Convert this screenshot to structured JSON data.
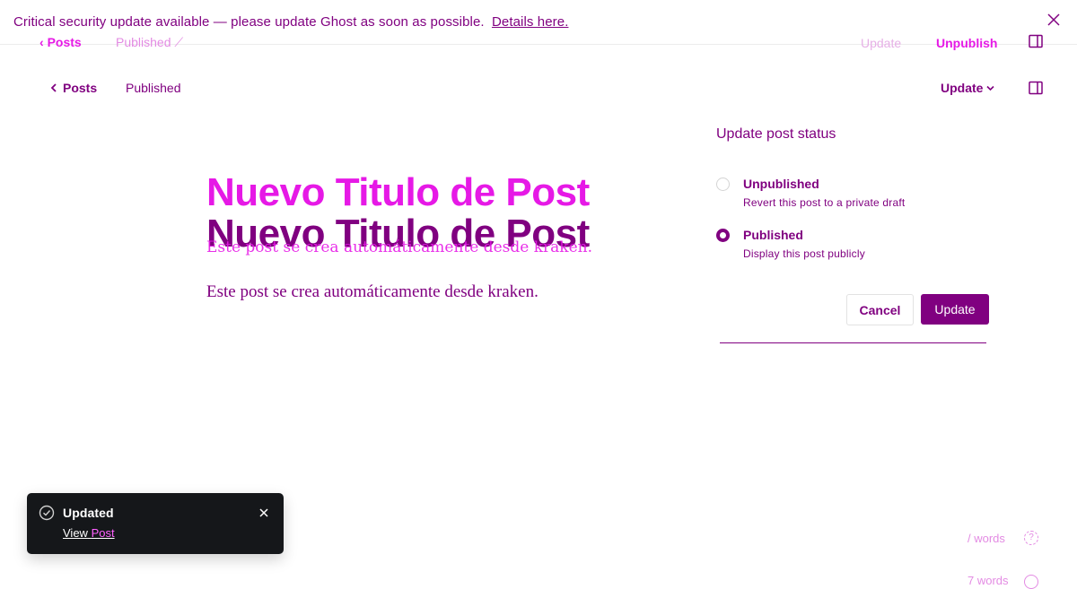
{
  "banner": {
    "message": "Critical security update available — please update Ghost as soon as possible.",
    "link": "Details here."
  },
  "ghost_header": {
    "back_label": "Posts",
    "status": "Published",
    "update_label": "Update",
    "unpublish_label": "Unpublish"
  },
  "header": {
    "back_label": "Posts",
    "status": "Published",
    "update_label": "Update"
  },
  "editor": {
    "title": "Nuevo Titulo de Post",
    "body": "Este post se crea automáticamente desde kraken.",
    "ghost_body": "Este post se crea automáticamente desde kraken."
  },
  "status_panel": {
    "heading": "Update post status",
    "options": [
      {
        "label": "Unpublished",
        "description": "Revert this post to a private draft",
        "selected": false
      },
      {
        "label": "Published",
        "description": "Display this post publicly",
        "selected": true
      }
    ],
    "cancel_label": "Cancel",
    "update_label": "Update"
  },
  "toast": {
    "title": "Updated",
    "link_part1": "View",
    "link_part2": "Post"
  },
  "footer": {
    "wordcount": "/ words",
    "help": "?",
    "wordcount_ghost": "7 words"
  },
  "colors": {
    "accent": "#800080",
    "ghost_accent": "#e619e6",
    "toast_bg": "#15171a"
  }
}
